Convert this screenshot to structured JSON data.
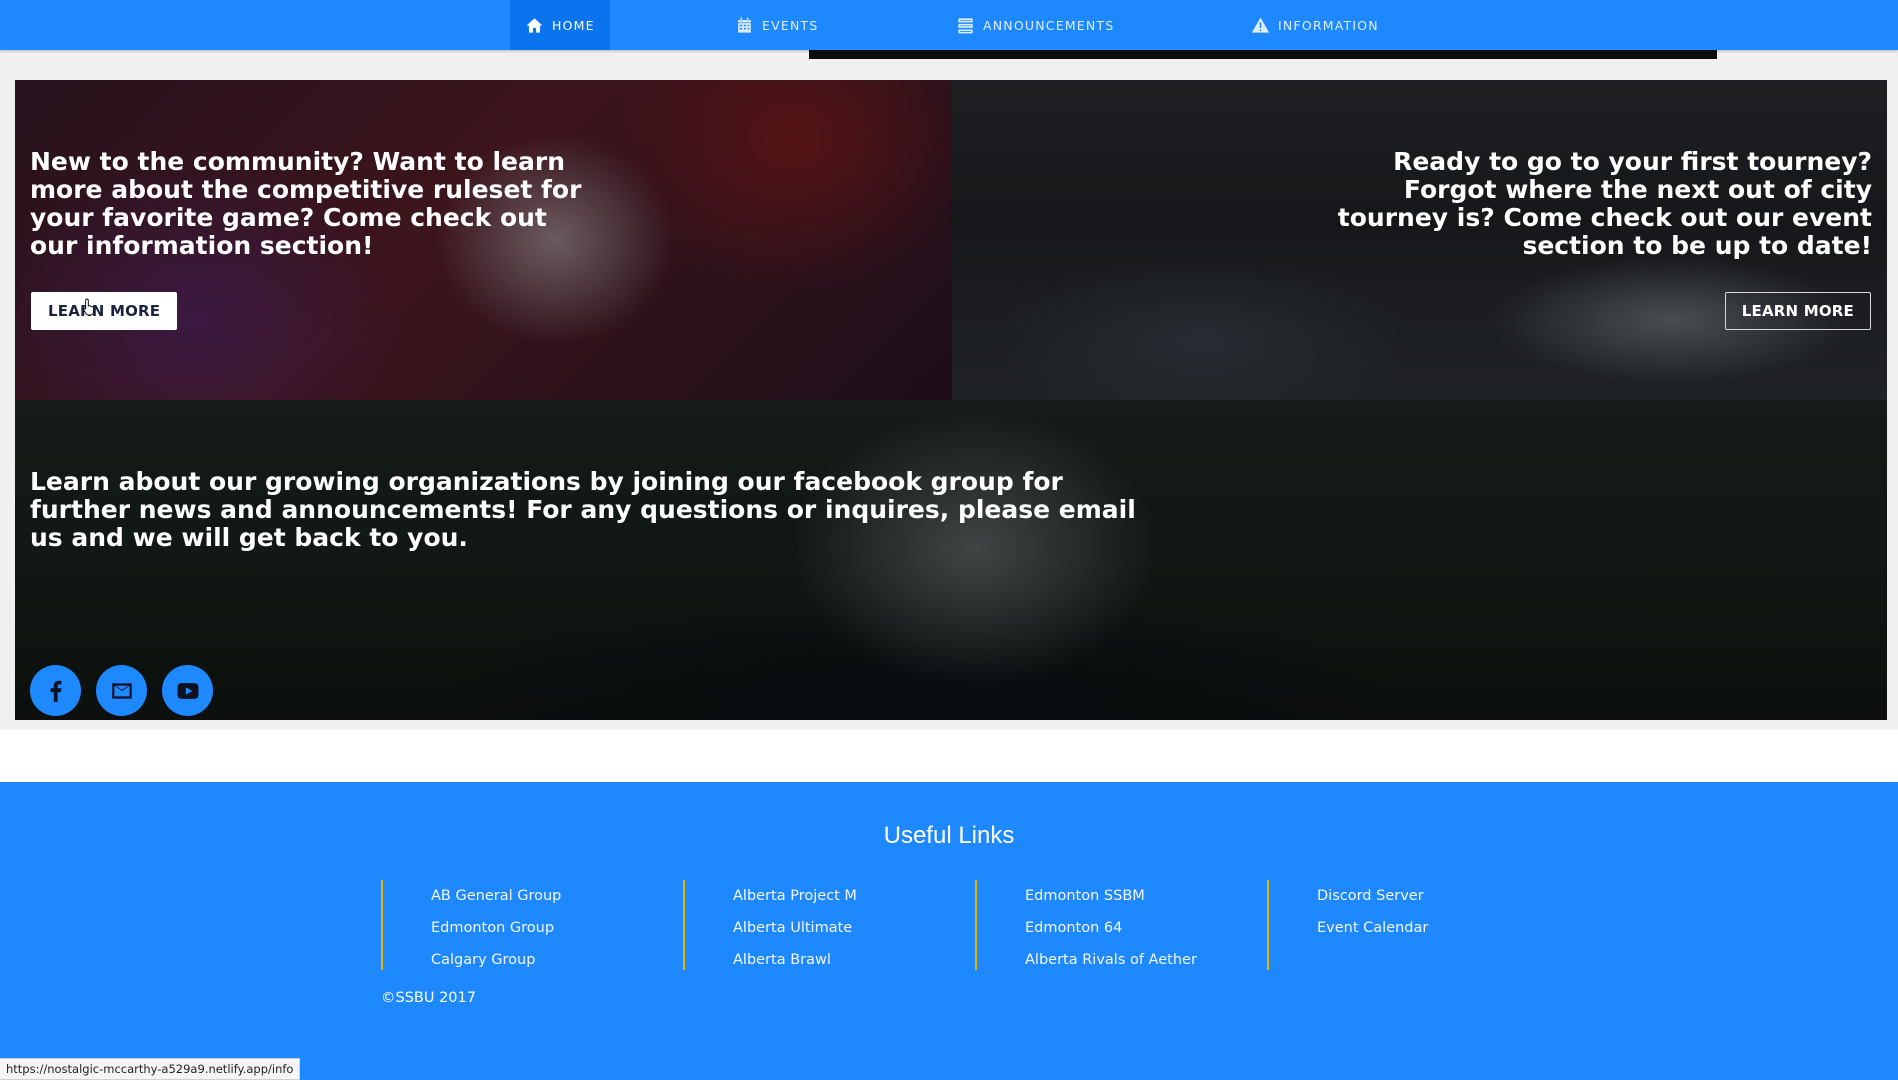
{
  "nav": {
    "items": [
      {
        "label": "HOME",
        "icon": "home-icon",
        "active": true
      },
      {
        "label": "EVENTS",
        "icon": "calendar-icon",
        "active": false
      },
      {
        "label": "ANNOUNCEMENTS",
        "icon": "list-icon",
        "active": false
      },
      {
        "label": "INFORMATION",
        "icon": "warning-icon",
        "active": false
      }
    ]
  },
  "panels": {
    "info": {
      "text": "New to the community? Want to learn more about the competitive ruleset for your favorite game? Come check out our information section!",
      "button_label": "LEARN MORE"
    },
    "events": {
      "text": "Ready to go to your first tourney? Forgot where the next out of city tourney is? Come check out our event section to be up to date!",
      "button_label": "LEARN MORE"
    },
    "community": {
      "text": "Learn about our growing organizations by joining our facebook group for further news and announcements! For any questions or inquires, please email us and we will get back to you.",
      "social": [
        {
          "name": "facebook",
          "icon": "facebook-icon"
        },
        {
          "name": "email",
          "icon": "mail-icon"
        },
        {
          "name": "youtube",
          "icon": "youtube-icon"
        }
      ]
    }
  },
  "footer": {
    "title": "Useful Links",
    "columns": [
      {
        "links": [
          "AB General Group",
          "Edmonton Group",
          "Calgary Group"
        ]
      },
      {
        "links": [
          "Alberta Project M",
          "Alberta Ultimate",
          "Alberta Brawl"
        ]
      },
      {
        "links": [
          "Edmonton SSBM",
          "Edmonton 64",
          "Alberta Rivals of Aether"
        ]
      },
      {
        "links": [
          "Discord Server",
          "Event Calendar"
        ]
      }
    ],
    "copyright": "©SSBU 2017"
  },
  "status_bar": {
    "url": "https://nostalgic-mccarthy-a529a9.netlify.app/info"
  },
  "colors": {
    "brand_blue": "#1e88ff",
    "active_nav": "#0a74ef",
    "column_divider": "#e6b400"
  }
}
